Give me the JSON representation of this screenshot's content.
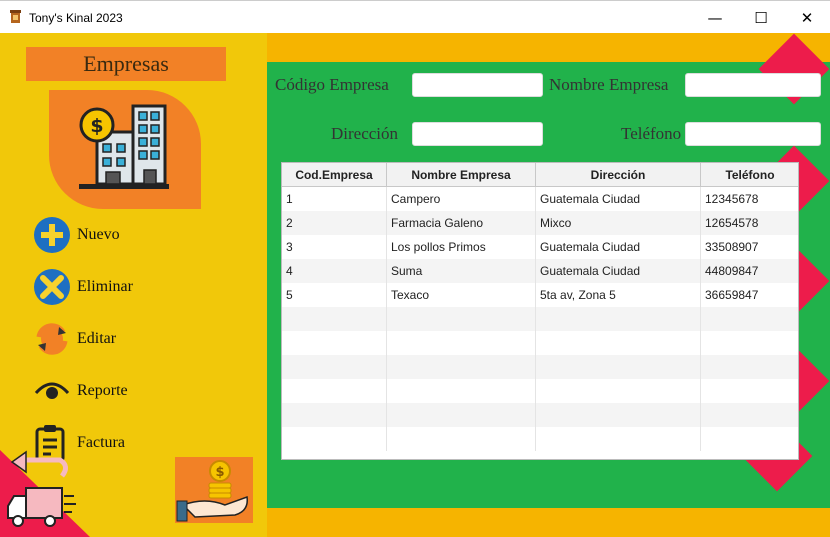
{
  "window": {
    "title": "Tony's Kinal 2023",
    "minimize": "—",
    "maximize": "☐",
    "close": "✕"
  },
  "sidebar": {
    "title": "Empresas",
    "menu": [
      {
        "label": "Nuevo",
        "icon": "plus-circle-icon"
      },
      {
        "label": "Eliminar",
        "icon": "x-circle-icon"
      },
      {
        "label": "Editar",
        "icon": "refresh-icon"
      },
      {
        "label": "Reporte",
        "icon": "eye-icon"
      },
      {
        "label": "Factura",
        "icon": "clipboard-icon"
      }
    ]
  },
  "form": {
    "codigo_label": "Código Empresa",
    "nombre_label": "Nombre Empresa",
    "direccion_label": "Dirección",
    "telefono_label": "Teléfono",
    "codigo_value": "",
    "nombre_value": "",
    "direccion_value": "",
    "telefono_value": ""
  },
  "table": {
    "columns": [
      "Cod.Empresa",
      "Nombre Empresa",
      "Dirección",
      "Teléfono"
    ],
    "rows": [
      [
        "1",
        "Campero",
        "Guatemala Ciudad",
        "12345678"
      ],
      [
        "2",
        "Farmacia Galeno",
        "Mixco",
        "12654578"
      ],
      [
        "3",
        "Los pollos Primos",
        "Guatemala Ciudad",
        "33508907"
      ],
      [
        "4",
        "Suma",
        "Guatemala Ciudad",
        "44809847"
      ],
      [
        "5",
        "Texaco",
        "5ta av, Zona 5",
        "36659847"
      ]
    ]
  },
  "colors": {
    "sidebar": "#f1c80a",
    "accent_orange": "#f28126",
    "green": "#21b24b",
    "red": "#ed1c4b",
    "amber": "#f6b400"
  }
}
